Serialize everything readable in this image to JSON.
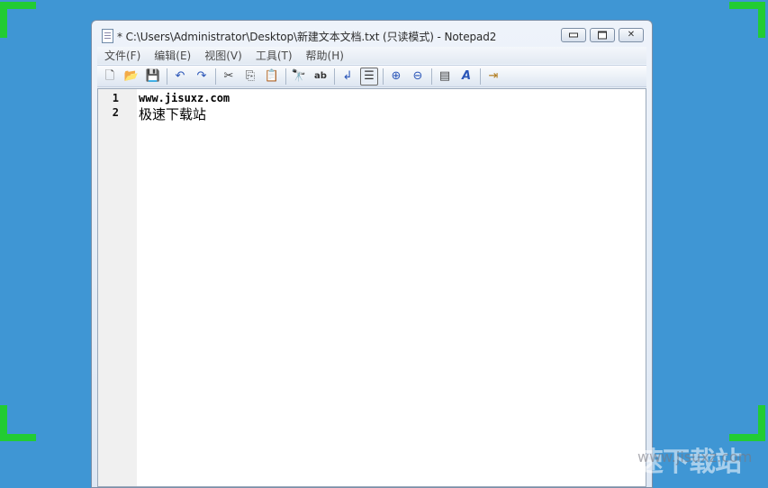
{
  "window": {
    "title": "* C:\\Users\\Administrator\\Desktop\\新建文本文档.txt (只读模式) - Notepad2"
  },
  "menu": {
    "items": [
      "文件(F)",
      "编辑(E)",
      "视图(V)",
      "工具(T)",
      "帮助(H)"
    ]
  },
  "toolbar": {
    "buttons": [
      {
        "icon": "new-file-icon",
        "glyph": "🗋"
      },
      {
        "icon": "open-folder-icon",
        "glyph": "📂"
      },
      {
        "icon": "save-icon",
        "glyph": "💾"
      },
      {
        "icon": "undo-icon",
        "glyph": "↶"
      },
      {
        "icon": "redo-icon",
        "glyph": "↷"
      },
      {
        "icon": "cut-icon",
        "glyph": "✂"
      },
      {
        "icon": "copy-icon",
        "glyph": "⎘"
      },
      {
        "icon": "paste-icon",
        "glyph": "📋"
      },
      {
        "icon": "find-icon",
        "glyph": "🔭"
      },
      {
        "icon": "replace-icon",
        "glyph": "ab"
      },
      {
        "icon": "word-wrap-icon",
        "glyph": "↲"
      },
      {
        "icon": "view-toggle-icon",
        "glyph": "☰"
      },
      {
        "icon": "zoom-in-icon",
        "glyph": "⊕"
      },
      {
        "icon": "zoom-out-icon",
        "glyph": "⊖"
      },
      {
        "icon": "scheme-icon",
        "glyph": "▤"
      },
      {
        "icon": "font-icon",
        "glyph": "A"
      },
      {
        "icon": "exit-icon",
        "glyph": "⇥"
      }
    ]
  },
  "editor": {
    "lines": [
      {
        "num": "1",
        "text": "www.jisuxz.com"
      },
      {
        "num": "2",
        "text": "极速下载站"
      }
    ]
  },
  "watermark": {
    "text": "极速下载站",
    "sub": "www.jisuxz.com"
  },
  "colors": {
    "desktop": "#3f96d4",
    "corner_marks": "#22cc33"
  }
}
